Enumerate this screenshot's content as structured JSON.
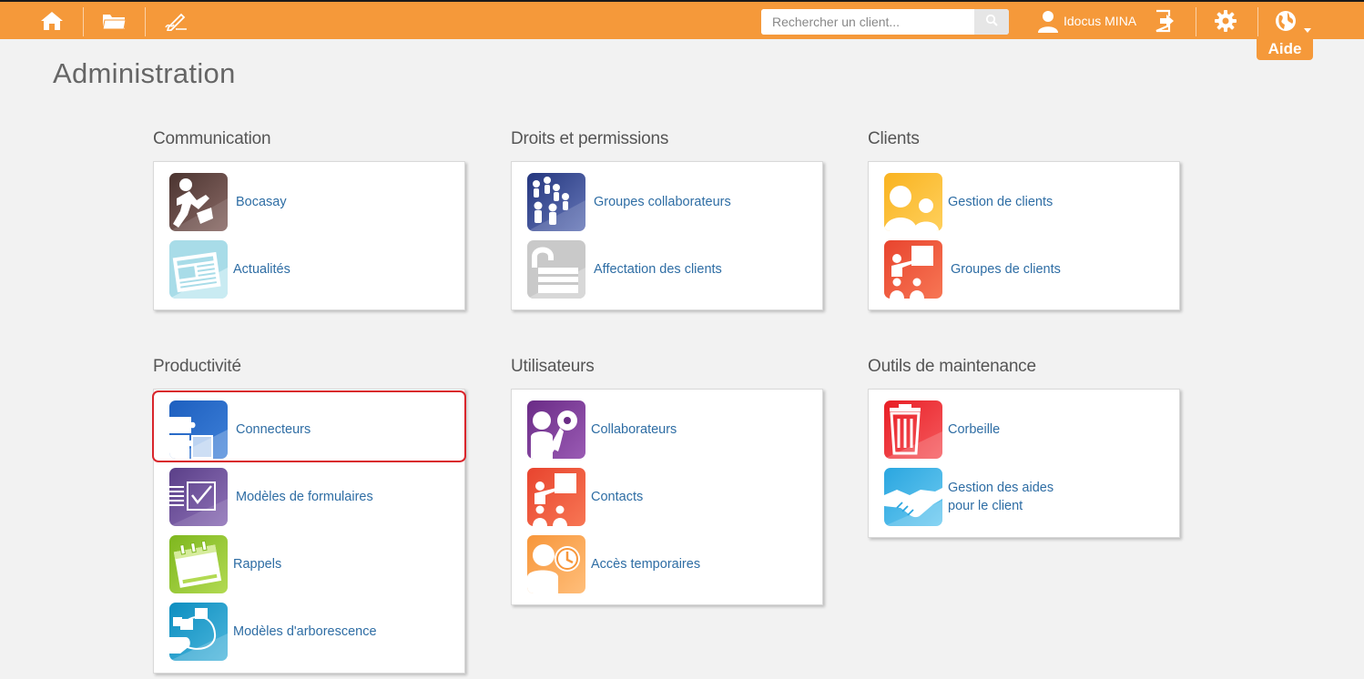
{
  "topbar": {
    "search_placeholder": "Rechercher un client...",
    "user_name": "Idocus MINA",
    "help_label": "Aide",
    "icons": [
      "home-icon",
      "folder-icon",
      "edit-signature-icon",
      "search-icon",
      "user-icon",
      "logout-icon",
      "gear-icon",
      "globe-icon",
      "caret-down-icon"
    ]
  },
  "page": {
    "title": "Administration"
  },
  "sections": {
    "communication": {
      "title": "Communication",
      "items": [
        {
          "label": "Bocasay"
        },
        {
          "label": "Actualités"
        }
      ]
    },
    "droits": {
      "title": "Droits et permissions",
      "items": [
        {
          "label": "Groupes collaborateurs"
        },
        {
          "label": "Affectation des clients"
        }
      ]
    },
    "clients": {
      "title": "Clients",
      "items": [
        {
          "label": "Gestion de clients"
        },
        {
          "label": "Groupes de clients"
        }
      ]
    },
    "productivite": {
      "title": "Productivité",
      "items": [
        {
          "label": "Connecteurs"
        },
        {
          "label": "Modèles de formulaires"
        },
        {
          "label": "Rappels"
        },
        {
          "label": "Modèles d'arborescence"
        }
      ]
    },
    "utilisateurs": {
      "title": "Utilisateurs",
      "items": [
        {
          "label": "Collaborateurs"
        },
        {
          "label": "Contacts"
        },
        {
          "label": "Accès temporaires"
        }
      ]
    },
    "maintenance": {
      "title": "Outils de maintenance",
      "items": [
        {
          "label": "Corbeille"
        },
        {
          "label": "Gestion des aides",
          "label2": "pour le client"
        }
      ]
    }
  },
  "colors": {
    "topbar": "#f5993a",
    "link": "#2e6da4",
    "highlight": "#d9262c"
  }
}
